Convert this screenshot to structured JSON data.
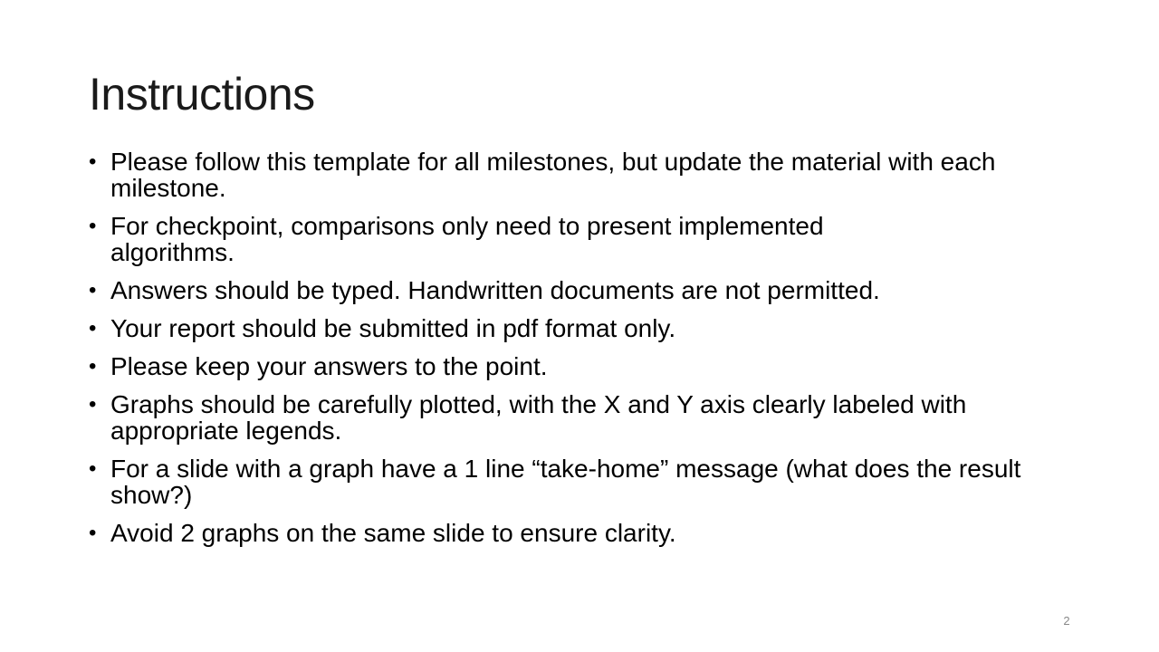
{
  "slide": {
    "title": "Instructions",
    "page_number": "2",
    "bullet_char": "•",
    "bullets": [
      "Please follow this template for all milestones, but update the material with each milestone.",
      "For checkpoint, comparisons only need to present implemented algorithms.",
      "Answers should be typed. Handwritten documents are not permitted.",
      "Your report should be submitted in pdf format only.",
      "Please keep your answers to the point.",
      "Graphs should be carefully plotted, with the X and Y axis clearly labeled with appropriate legends.",
      "For a slide with a graph have a 1 line “take-home” message (what does the result show?)",
      "Avoid 2 graphs on the same slide to ensure clarity."
    ]
  }
}
